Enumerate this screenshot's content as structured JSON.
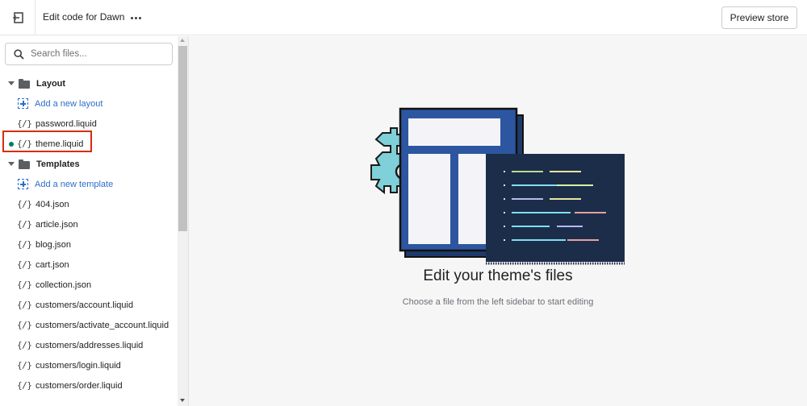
{
  "topbar": {
    "exit_icon": "exit-arrow-icon",
    "title": "Edit code for Dawn",
    "more_icon": "ellipsis-icon",
    "preview_label": "Preview store"
  },
  "sidebar": {
    "search": {
      "placeholder": "Search files...",
      "value": "",
      "icon": "search-icon"
    },
    "folders": [
      {
        "name": "Layout",
        "add_label": "Add a new layout",
        "files": [
          {
            "name": "password.liquid",
            "active": false
          },
          {
            "name": "theme.liquid",
            "active": true,
            "highlighted": true
          }
        ]
      },
      {
        "name": "Templates",
        "add_label": "Add a new template",
        "files": [
          {
            "name": "404.json"
          },
          {
            "name": "article.json"
          },
          {
            "name": "blog.json"
          },
          {
            "name": "cart.json"
          },
          {
            "name": "collection.json"
          },
          {
            "name": "customers/account.liquid"
          },
          {
            "name": "customers/activate_account.liquid"
          },
          {
            "name": "customers/addresses.liquid"
          },
          {
            "name": "customers/login.liquid"
          },
          {
            "name": "customers/order.liquid"
          }
        ]
      }
    ],
    "file_icon_glyph": "{/}",
    "active_dot_color": "#007f5f",
    "highlight_color": "#d72c0d"
  },
  "main": {
    "empty_title": "Edit your theme's files",
    "empty_subtitle": "Choose a file from the left sidebar to start editing",
    "illustration": "theme-code-illustration"
  }
}
